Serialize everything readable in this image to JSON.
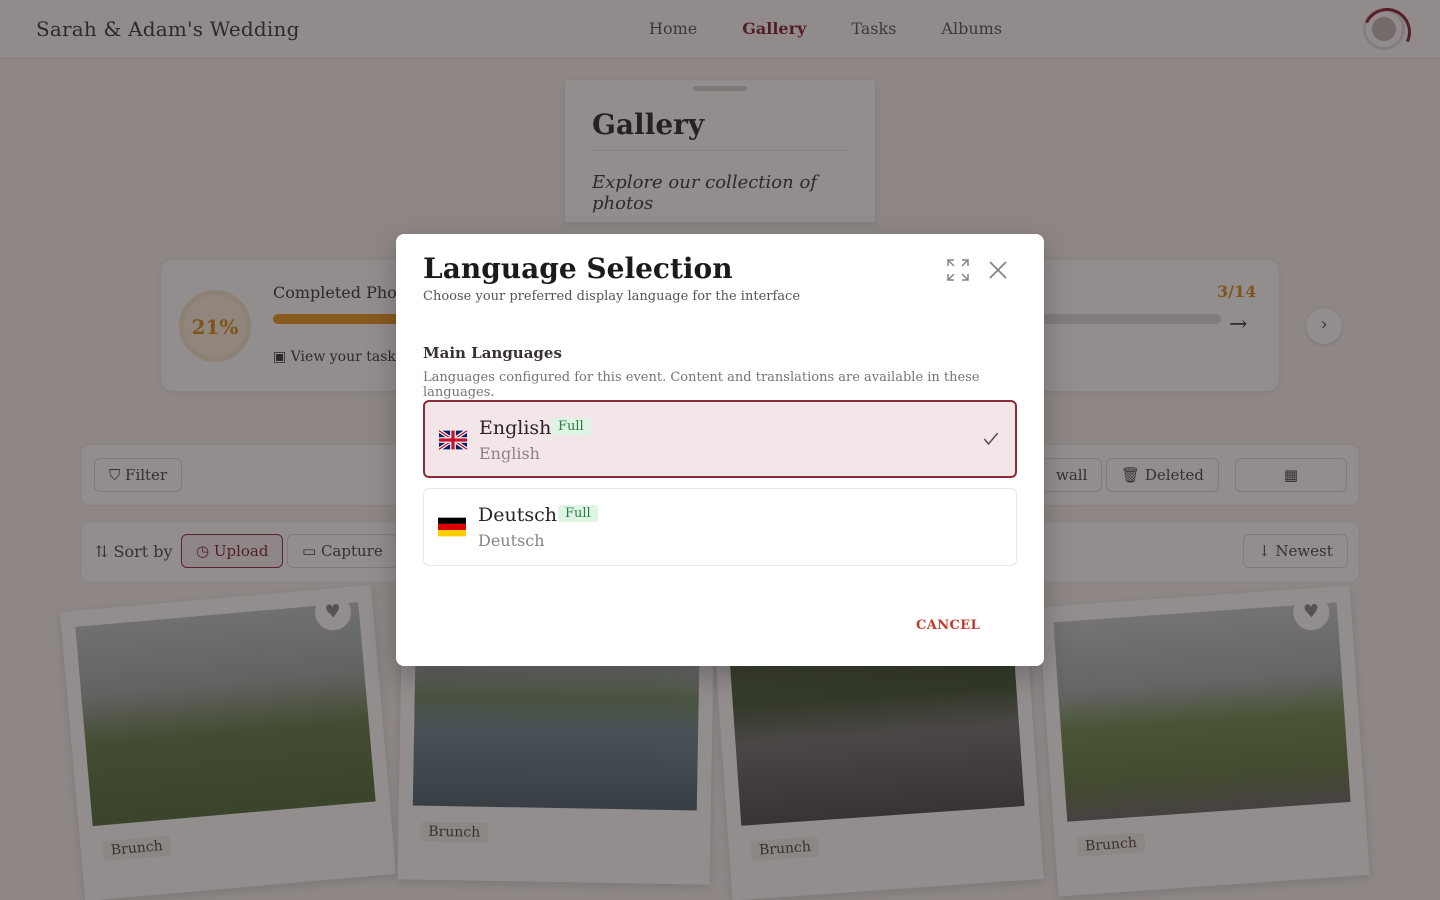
{
  "header": {
    "brand": "Sarah & Adam's Wedding",
    "nav": [
      "Home",
      "Gallery",
      "Tasks",
      "Albums"
    ],
    "active_nav": "Gallery"
  },
  "gallery_card": {
    "title": "Gallery",
    "subtitle": "Explore our collection of photos"
  },
  "progress": {
    "percent_label": "21%",
    "completed_label": "Completed Photo",
    "view_task_label": "View your task p",
    "count": "3/14"
  },
  "filters": {
    "filter_label": "Filter",
    "photowall_label": "wall",
    "deleted_label": "Deleted"
  },
  "sort": {
    "label": "Sort by",
    "upload_label": "Upload",
    "capture_label": "Capture",
    "newest_label": "Newest"
  },
  "photos": [
    {
      "tag": "Brunch"
    },
    {
      "tag": "Brunch"
    },
    {
      "tag": "Brunch"
    },
    {
      "tag": "Brunch"
    }
  ],
  "modal": {
    "title": "Language Selection",
    "subtitle": "Choose your preferred display language for the interface",
    "section_title": "Main Languages",
    "section_desc": "Languages configured for this event. Content and translations are available in these languages.",
    "languages": [
      {
        "name": "English",
        "native": "English",
        "badge": "Full",
        "selected": true,
        "flag": "uk-flag-icon"
      },
      {
        "name": "Deutsch",
        "native": "Deutsch",
        "badge": "Full",
        "selected": false,
        "flag": "germany-flag-icon"
      }
    ],
    "cancel_label": "CANCEL"
  },
  "colors": {
    "accent": "#8a2c3a",
    "badge_bg": "#def5e5",
    "badge_text": "#2f7a44",
    "cancel": "#c0392b",
    "progress": "#e8961e"
  }
}
